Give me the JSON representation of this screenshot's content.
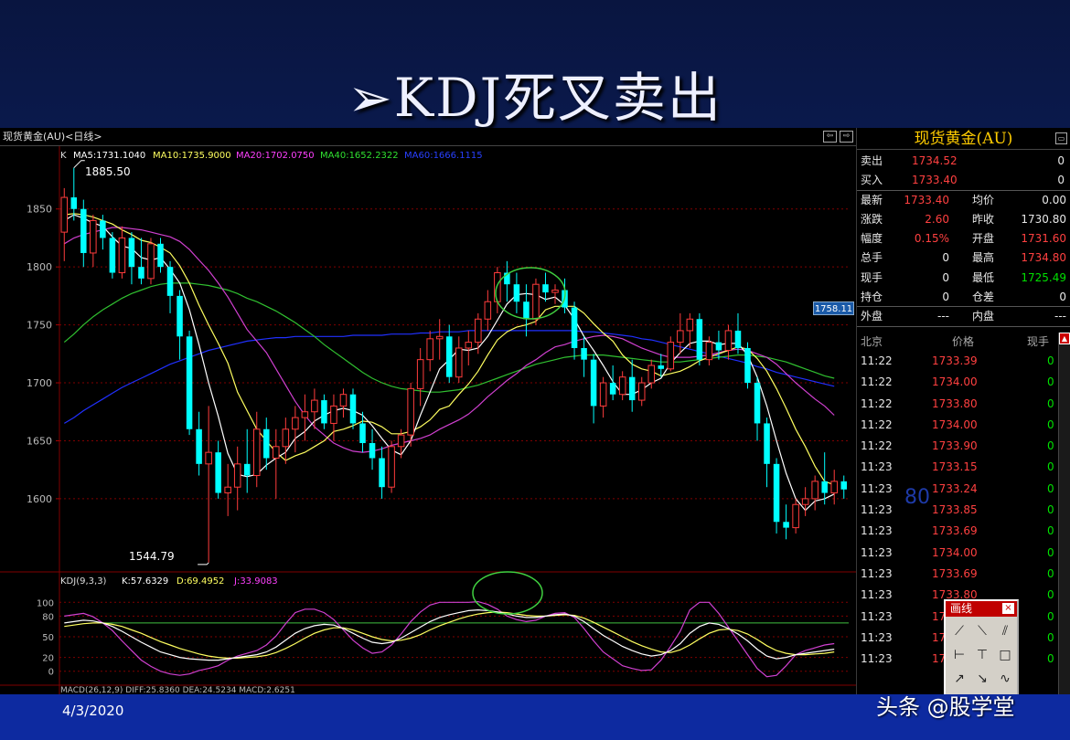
{
  "slide": {
    "title": "➢KDJ死叉卖出",
    "date": "4/3/2020",
    "watermark": "头条 @股学堂"
  },
  "window": {
    "title": "现货黄金(AU)<日线>",
    "btn_left": "⇦",
    "btn_right": "⇨"
  },
  "ma_legend": {
    "k": "K",
    "ma5": "MA5:1731.1040",
    "ma10": "MA10:1735.9000",
    "ma20": "MA20:1702.0750",
    "ma40": "MA40:1652.2322",
    "ma60": "MA60:1666.1115"
  },
  "kdj_legend": {
    "name": "KDJ(9,3,3)",
    "k": "K:57.6329",
    "d": "D:69.4952",
    "j": "J:33.9083"
  },
  "macd_legend": "MACD(26,12,9) DIFF:25.8360 DEA:24.5234 MACD:2.6251",
  "price_marker": "1758.11",
  "overlay_80": "80",
  "annotations": {
    "high": "1885.50",
    "low": "1544.79"
  },
  "colors": {
    "up": "#ff3c3c",
    "down": "#00ffff",
    "ma5": "#ffffff",
    "ma10": "#ffff60",
    "ma20": "#d040d0",
    "ma40": "#30c030",
    "ma60": "#2030ff"
  },
  "chart_data": {
    "type": "candlestick",
    "price_axis": {
      "ticks": [
        1600,
        1650,
        1700,
        1750,
        1800,
        1850
      ],
      "range": [
        1540,
        1890
      ]
    },
    "kdj_axis": {
      "ticks": [
        0,
        20,
        50,
        80,
        100
      ],
      "range": [
        -15,
        115
      ]
    },
    "candles": [
      [
        1830,
        1868,
        1805,
        1860
      ],
      [
        1860,
        1885.5,
        1840,
        1850
      ],
      [
        1850,
        1858,
        1800,
        1812
      ],
      [
        1812,
        1845,
        1800,
        1840
      ],
      [
        1840,
        1845,
        1815,
        1825
      ],
      [
        1825,
        1830,
        1790,
        1795
      ],
      [
        1795,
        1835,
        1790,
        1825
      ],
      [
        1825,
        1830,
        1785,
        1800
      ],
      [
        1800,
        1825,
        1785,
        1790
      ],
      [
        1790,
        1825,
        1785,
        1820
      ],
      [
        1820,
        1825,
        1795,
        1800
      ],
      [
        1800,
        1805,
        1760,
        1775
      ],
      [
        1775,
        1780,
        1720,
        1740
      ],
      [
        1740,
        1745,
        1655,
        1660
      ],
      [
        1660,
        1675,
        1620,
        1630
      ],
      [
        1630,
        1680,
        1544.79,
        1640
      ],
      [
        1640,
        1650,
        1600,
        1605
      ],
      [
        1605,
        1630,
        1585,
        1610
      ],
      [
        1610,
        1645,
        1590,
        1630
      ],
      [
        1630,
        1660,
        1605,
        1620
      ],
      [
        1620,
        1675,
        1610,
        1660
      ],
      [
        1660,
        1670,
        1625,
        1635
      ],
      [
        1635,
        1660,
        1600,
        1645
      ],
      [
        1645,
        1670,
        1630,
        1660
      ],
      [
        1660,
        1680,
        1640,
        1670
      ],
      [
        1670,
        1690,
        1650,
        1675
      ],
      [
        1675,
        1695,
        1660,
        1685
      ],
      [
        1685,
        1690,
        1660,
        1665
      ],
      [
        1665,
        1690,
        1650,
        1680
      ],
      [
        1680,
        1695,
        1670,
        1690
      ],
      [
        1690,
        1695,
        1660,
        1665
      ],
      [
        1665,
        1675,
        1640,
        1648
      ],
      [
        1648,
        1660,
        1625,
        1635
      ],
      [
        1635,
        1645,
        1600,
        1610
      ],
      [
        1610,
        1650,
        1605,
        1645
      ],
      [
        1645,
        1660,
        1635,
        1655
      ],
      [
        1655,
        1700,
        1645,
        1695
      ],
      [
        1695,
        1730,
        1680,
        1720
      ],
      [
        1720,
        1745,
        1710,
        1738
      ],
      [
        1738,
        1755,
        1720,
        1740
      ],
      [
        1740,
        1750,
        1700,
        1705
      ],
      [
        1705,
        1740,
        1700,
        1730
      ],
      [
        1730,
        1745,
        1715,
        1735
      ],
      [
        1735,
        1760,
        1725,
        1755
      ],
      [
        1755,
        1780,
        1745,
        1770
      ],
      [
        1770,
        1800,
        1760,
        1795
      ],
      [
        1795,
        1805,
        1770,
        1785
      ],
      [
        1785,
        1795,
        1760,
        1770
      ],
      [
        1770,
        1785,
        1740,
        1755
      ],
      [
        1755,
        1790,
        1750,
        1785
      ],
      [
        1785,
        1795,
        1770,
        1778
      ],
      [
        1778,
        1785,
        1768,
        1780
      ],
      [
        1780,
        1790,
        1760,
        1765
      ],
      [
        1765,
        1770,
        1720,
        1730
      ],
      [
        1730,
        1740,
        1705,
        1720
      ],
      [
        1720,
        1725,
        1665,
        1680
      ],
      [
        1680,
        1705,
        1670,
        1700
      ],
      [
        1700,
        1715,
        1685,
        1690
      ],
      [
        1690,
        1710,
        1685,
        1705
      ],
      [
        1705,
        1720,
        1675,
        1685
      ],
      [
        1685,
        1705,
        1680,
        1700
      ],
      [
        1700,
        1720,
        1695,
        1715
      ],
      [
        1715,
        1725,
        1705,
        1712
      ],
      [
        1712,
        1740,
        1710,
        1735
      ],
      [
        1735,
        1760,
        1725,
        1745
      ],
      [
        1745,
        1760,
        1730,
        1755
      ],
      [
        1755,
        1760,
        1715,
        1720
      ],
      [
        1720,
        1740,
        1715,
        1735
      ],
      [
        1735,
        1745,
        1720,
        1728
      ],
      [
        1728,
        1750,
        1720,
        1745
      ],
      [
        1745,
        1760,
        1725,
        1730
      ],
      [
        1730,
        1735,
        1695,
        1700
      ],
      [
        1700,
        1705,
        1650,
        1665
      ],
      [
        1665,
        1670,
        1610,
        1630
      ],
      [
        1630,
        1635,
        1570,
        1580
      ],
      [
        1580,
        1595,
        1565,
        1575
      ],
      [
        1575,
        1600,
        1570,
        1595
      ],
      [
        1595,
        1610,
        1585,
        1600
      ],
      [
        1600,
        1620,
        1590,
        1615
      ],
      [
        1615,
        1640,
        1595,
        1605
      ],
      [
        1605,
        1625,
        1595,
        1615
      ],
      [
        1615,
        1620,
        1600,
        1608
      ]
    ],
    "ma5": [
      1840,
      1845,
      1842,
      1838,
      1835,
      1826,
      1818,
      1816,
      1808,
      1806,
      1808,
      1798,
      1786,
      1763,
      1733,
      1700,
      1671,
      1639,
      1621,
      1619,
      1621,
      1629,
      1635,
      1640,
      1652,
      1658,
      1667,
      1672,
      1676,
      1678,
      1676,
      1672,
      1663,
      1652,
      1642,
      1638,
      1650,
      1672,
      1692,
      1712,
      1720,
      1729,
      1728,
      1730,
      1740,
      1754,
      1768,
      1776,
      1777,
      1776,
      1772,
      1774,
      1767,
      1755,
      1740,
      1728,
      1715,
      1701,
      1690,
      1690,
      1694,
      1700,
      1704,
      1717,
      1726,
      1734,
      1736,
      1736,
      1733,
      1734,
      1734,
      1724,
      1705,
      1680,
      1650,
      1622,
      1600,
      1590,
      1598,
      1600,
      1604
    ],
    "ma10": [
      1845,
      1846,
      1845,
      1843,
      1840,
      1837,
      1832,
      1828,
      1823,
      1821,
      1817,
      1812,
      1801,
      1786,
      1767,
      1750,
      1734,
      1717,
      1692,
      1676,
      1660,
      1650,
      1640,
      1633,
      1637,
      1640,
      1645,
      1650,
      1658,
      1660,
      1663,
      1667,
      1666,
      1662,
      1656,
      1656,
      1658,
      1662,
      1668,
      1677,
      1680,
      1690,
      1699,
      1710,
      1724,
      1737,
      1744,
      1748,
      1750,
      1753,
      1763,
      1766,
      1766,
      1766,
      1760,
      1751,
      1743,
      1736,
      1724,
      1716,
      1712,
      1710,
      1706,
      1708,
      1710,
      1714,
      1719,
      1722,
      1725,
      1728,
      1731,
      1729,
      1721,
      1710,
      1695,
      1678,
      1660,
      1645,
      1628,
      1615,
      1612
    ],
    "ma20": [
      1820,
      1825,
      1828,
      1830,
      1832,
      1834,
      1834,
      1833,
      1832,
      1830,
      1828,
      1826,
      1822,
      1815,
      1806,
      1797,
      1786,
      1774,
      1760,
      1746,
      1736,
      1726,
      1712,
      1698,
      1684,
      1672,
      1662,
      1655,
      1648,
      1644,
      1641,
      1640,
      1641,
      1643,
      1646,
      1648,
      1650,
      1652,
      1655,
      1660,
      1664,
      1668,
      1673,
      1680,
      1688,
      1695,
      1702,
      1708,
      1715,
      1720,
      1726,
      1731,
      1733,
      1736,
      1738,
      1740,
      1741,
      1740,
      1738,
      1734,
      1730,
      1727,
      1724,
      1722,
      1722,
      1722,
      1723,
      1724,
      1726,
      1728,
      1729,
      1728,
      1725,
      1722,
      1716,
      1708,
      1700,
      1693,
      1686,
      1680,
      1672
    ],
    "ma40": [
      1735,
      1742,
      1750,
      1757,
      1763,
      1768,
      1773,
      1777,
      1780,
      1783,
      1785,
      1786,
      1786,
      1786,
      1785,
      1784,
      1782,
      1780,
      1777,
      1773,
      1770,
      1766,
      1762,
      1757,
      1752,
      1746,
      1740,
      1733,
      1727,
      1721,
      1715,
      1709,
      1704,
      1700,
      1697,
      1695,
      1694,
      1693,
      1692,
      1692,
      1693,
      1694,
      1696,
      1698,
      1701,
      1704,
      1707,
      1710,
      1713,
      1716,
      1718,
      1720,
      1722,
      1723,
      1724,
      1724,
      1724,
      1723,
      1722,
      1721,
      1720,
      1719,
      1718,
      1718,
      1718,
      1719,
      1720,
      1721,
      1722,
      1723,
      1724,
      1724,
      1723,
      1722,
      1720,
      1718,
      1715,
      1712,
      1709,
      1706,
      1704
    ],
    "ma60": [
      1665,
      1670,
      1676,
      1681,
      1686,
      1691,
      1696,
      1700,
      1704,
      1708,
      1712,
      1716,
      1719,
      1722,
      1725,
      1728,
      1730,
      1732,
      1734,
      1736,
      1737,
      1738,
      1739,
      1739,
      1740,
      1740,
      1740,
      1740,
      1740,
      1740,
      1741,
      1741,
      1741,
      1741,
      1742,
      1742,
      1742,
      1743,
      1743,
      1744,
      1744,
      1744,
      1745,
      1745,
      1745,
      1745,
      1745,
      1745,
      1745,
      1745,
      1745,
      1745,
      1745,
      1745,
      1744,
      1744,
      1743,
      1742,
      1741,
      1740,
      1738,
      1737,
      1735,
      1733,
      1731,
      1729,
      1727,
      1725,
      1723,
      1721,
      1719,
      1717,
      1714,
      1712,
      1709,
      1707,
      1705,
      1703,
      1701,
      1699,
      1697
    ],
    "kdj_k": [
      70,
      72,
      74,
      73,
      70,
      65,
      58,
      50,
      42,
      35,
      28,
      24,
      20,
      18,
      17,
      16,
      16,
      18,
      20,
      22,
      24,
      28,
      35,
      45,
      55,
      62,
      66,
      68,
      67,
      62,
      55,
      48,
      42,
      40,
      42,
      48,
      56,
      64,
      72,
      78,
      82,
      85,
      88,
      89,
      88,
      86,
      83,
      80,
      78,
      78,
      80,
      82,
      83,
      80,
      72,
      62,
      52,
      44,
      36,
      30,
      25,
      22,
      24,
      30,
      40,
      55,
      65,
      70,
      68,
      62,
      54,
      44,
      32,
      22,
      18,
      20,
      24,
      26,
      28,
      30,
      32
    ],
    "kdj_d": [
      65,
      67,
      69,
      70,
      70,
      68,
      65,
      60,
      55,
      49,
      43,
      38,
      33,
      29,
      25,
      22,
      20,
      19,
      19,
      20,
      21,
      23,
      27,
      33,
      40,
      48,
      55,
      60,
      63,
      63,
      60,
      55,
      50,
      46,
      44,
      45,
      48,
      53,
      60,
      66,
      71,
      76,
      80,
      83,
      85,
      86,
      85,
      83,
      81,
      80,
      80,
      81,
      82,
      81,
      77,
      71,
      64,
      57,
      50,
      43,
      37,
      32,
      28,
      27,
      31,
      38,
      47,
      55,
      60,
      61,
      59,
      54,
      46,
      37,
      30,
      26,
      24,
      24,
      25,
      26,
      28
    ],
    "kdj_j": [
      80,
      82,
      84,
      79,
      70,
      59,
      44,
      30,
      16,
      7,
      0,
      -4,
      -6,
      -4,
      1,
      4,
      8,
      16,
      22,
      26,
      30,
      38,
      51,
      69,
      85,
      90,
      90,
      85,
      75,
      60,
      45,
      34,
      26,
      28,
      38,
      54,
      72,
      86,
      96,
      100,
      100,
      100,
      100,
      101,
      97,
      90,
      80,
      75,
      72,
      74,
      80,
      84,
      85,
      78,
      62,
      44,
      28,
      18,
      8,
      4,
      1,
      2,
      16,
      36,
      58,
      89,
      100,
      100,
      84,
      64,
      44,
      24,
      4,
      -8,
      -6,
      8,
      24,
      30,
      34,
      38,
      40
    ]
  },
  "quote": {
    "title": "现货黄金(AU)",
    "rows": [
      {
        "l": "卖出",
        "v1": "1734.52",
        "v2": "0"
      },
      {
        "l": "买入",
        "v1": "1733.40",
        "v2": "0"
      }
    ],
    "stats": [
      {
        "a": "最新",
        "av": "1733.40",
        "b": "均价",
        "bv": "0.00"
      },
      {
        "a": "涨跌",
        "av": "2.60",
        "b": "昨收",
        "bv": "1730.80"
      },
      {
        "a": "幅度",
        "av": "0.15%",
        "b": "开盘",
        "bv": "1731.60"
      },
      {
        "a": "总手",
        "av": "0",
        "b": "最高",
        "bv": "1734.80"
      },
      {
        "a": "现手",
        "av": "0",
        "b": "最低",
        "bv": "1725.49"
      },
      {
        "a": "持仓",
        "av": "0",
        "b": "仓差",
        "bv": "0"
      },
      {
        "a": "外盘",
        "av": "---",
        "b": "内盘",
        "bv": "---"
      }
    ],
    "tick_header": {
      "a": "北京",
      "b": "价格",
      "c": "现手"
    },
    "ticks": [
      {
        "t": "11:22",
        "p": "1733.39",
        "v": "0"
      },
      {
        "t": "11:22",
        "p": "1734.00",
        "v": "0"
      },
      {
        "t": "11:22",
        "p": "1733.80",
        "v": "0"
      },
      {
        "t": "11:22",
        "p": "1734.00",
        "v": "0"
      },
      {
        "t": "11:22",
        "p": "1733.90",
        "v": "0"
      },
      {
        "t": "11:23",
        "p": "1733.15",
        "v": "0"
      },
      {
        "t": "11:23",
        "p": "1733.24",
        "v": "0"
      },
      {
        "t": "11:23",
        "p": "1733.85",
        "v": "0"
      },
      {
        "t": "11:23",
        "p": "1733.69",
        "v": "0"
      },
      {
        "t": "11:23",
        "p": "1734.00",
        "v": "0"
      },
      {
        "t": "11:23",
        "p": "1733.69",
        "v": "0"
      },
      {
        "t": "11:23",
        "p": "1733.80",
        "v": "0"
      },
      {
        "t": "11:23",
        "p": "1733.85",
        "v": "0"
      },
      {
        "t": "11:23",
        "p": "1733.80",
        "v": "0"
      },
      {
        "t": "11:23",
        "p": "1733.85",
        "v": "0"
      }
    ]
  },
  "draw_panel": {
    "title": "画线",
    "close": "×"
  }
}
